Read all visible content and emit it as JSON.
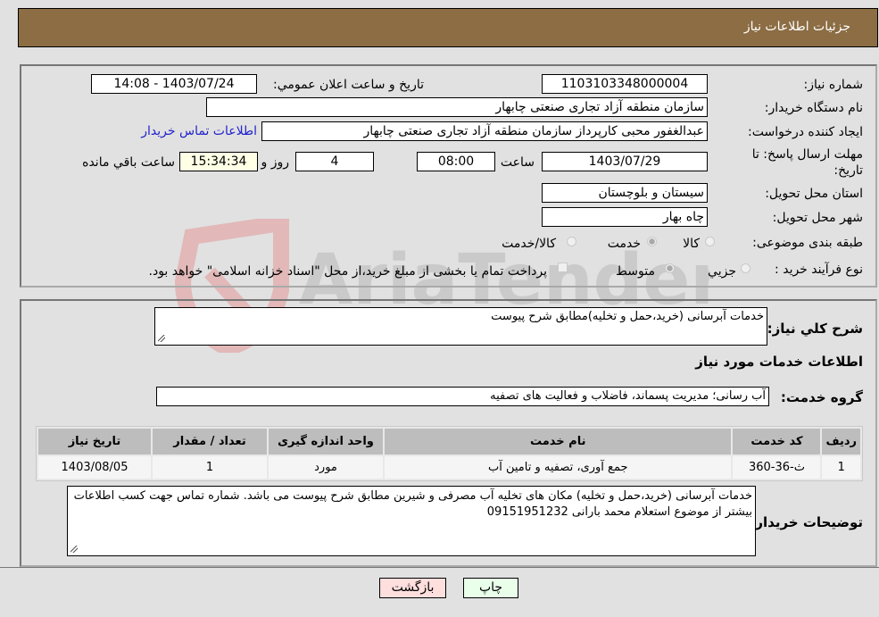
{
  "header": {
    "title": "جزئیات اطلاعات نیاز"
  },
  "form": {
    "need_number_label": "شماره نیاز:",
    "need_number": "1103103348000004",
    "announce_label": "تاریخ و ساعت اعلان عمومي:",
    "announce_value": "1403/07/24 - 14:08",
    "buyer_org_label": "نام دستگاه خریدار:",
    "buyer_org": "سازمان منطقه آزاد تجاری صنعتی چابهار",
    "creator_label": "ایجاد کننده درخواست:",
    "creator": "عبدالغفور محبی کارپرداز سازمان منطقه آزاد تجاری صنعتی چابهار",
    "contact_link": "اطلاعات تماس خریدار",
    "deadline_label": "مهلت ارسال پاسخ: تا تاریخ:",
    "deadline_date": "1403/07/29",
    "time_label": "ساعت",
    "deadline_time": "08:00",
    "days_remaining": "4",
    "days_label": "روز و",
    "time_remaining": "15:34:34",
    "remaining_label": "ساعت باقي مانده",
    "province_label": "استان محل تحویل:",
    "province": "سیستان و بلوچستان",
    "city_label": "شهر محل تحویل:",
    "city": "چاه بهار",
    "category_label": "طبقه بندی موضوعی:",
    "category_options": [
      {
        "label": "کالا",
        "checked": false
      },
      {
        "label": "خدمت",
        "checked": true
      },
      {
        "label": "کالا/خدمت",
        "checked": false
      }
    ],
    "process_label": "نوع فرآیند خرید :",
    "process_options": [
      {
        "label": "جزيي",
        "checked": false
      },
      {
        "label": "متوسط",
        "checked": true
      }
    ],
    "treasury_checkbox_label": "پرداخت تمام یا بخشی از مبلغ خرید،از محل \"اسناد خزانه اسلامی\" خواهد بود.",
    "treasury_checked": false
  },
  "details": {
    "general_desc_label": "شرح کلي نياز:",
    "general_desc": "خدمات آبرسانی (خرید،حمل و تخلیه)مطابق شرح پیوست",
    "services_heading": "اطلاعات خدمات مورد نياز",
    "service_group_label": "گروه خدمت:",
    "service_group": "آب رسانی؛ مدیریت پسماند، فاضلاب و فعالیت های تصفیه",
    "table": {
      "headers": [
        "رديف",
        "کد خدمت",
        "نام خدمت",
        "واحد اندازه گيری",
        "تعداد / مقدار",
        "تاريخ نياز"
      ],
      "rows": [
        [
          "1",
          "ث-36-360",
          "جمع آوری، تصفیه و تامین آب",
          "مورد",
          "1",
          "1403/08/05"
        ]
      ]
    },
    "buyer_notes_label": "توضیحات خریدار:",
    "buyer_notes": "خدمات آبرسانی (خرید،حمل و تخلیه)  مکان های تخلیه آب مصرفی و شیرین مطابق شرح پیوست می باشد. شماره تماس جهت کسب اطلاعات بیشتر از موضوع استعلام  محمد بارانی 09151951232"
  },
  "buttons": {
    "print": "چاپ",
    "back": "بازگشت"
  },
  "watermark": {
    "text": "AriaTender.neT"
  },
  "colors": {
    "header_bg": "#8c6d44",
    "print_bg": "#e9ffe9",
    "back_bg": "#ffdede",
    "link": "#2222cc"
  }
}
